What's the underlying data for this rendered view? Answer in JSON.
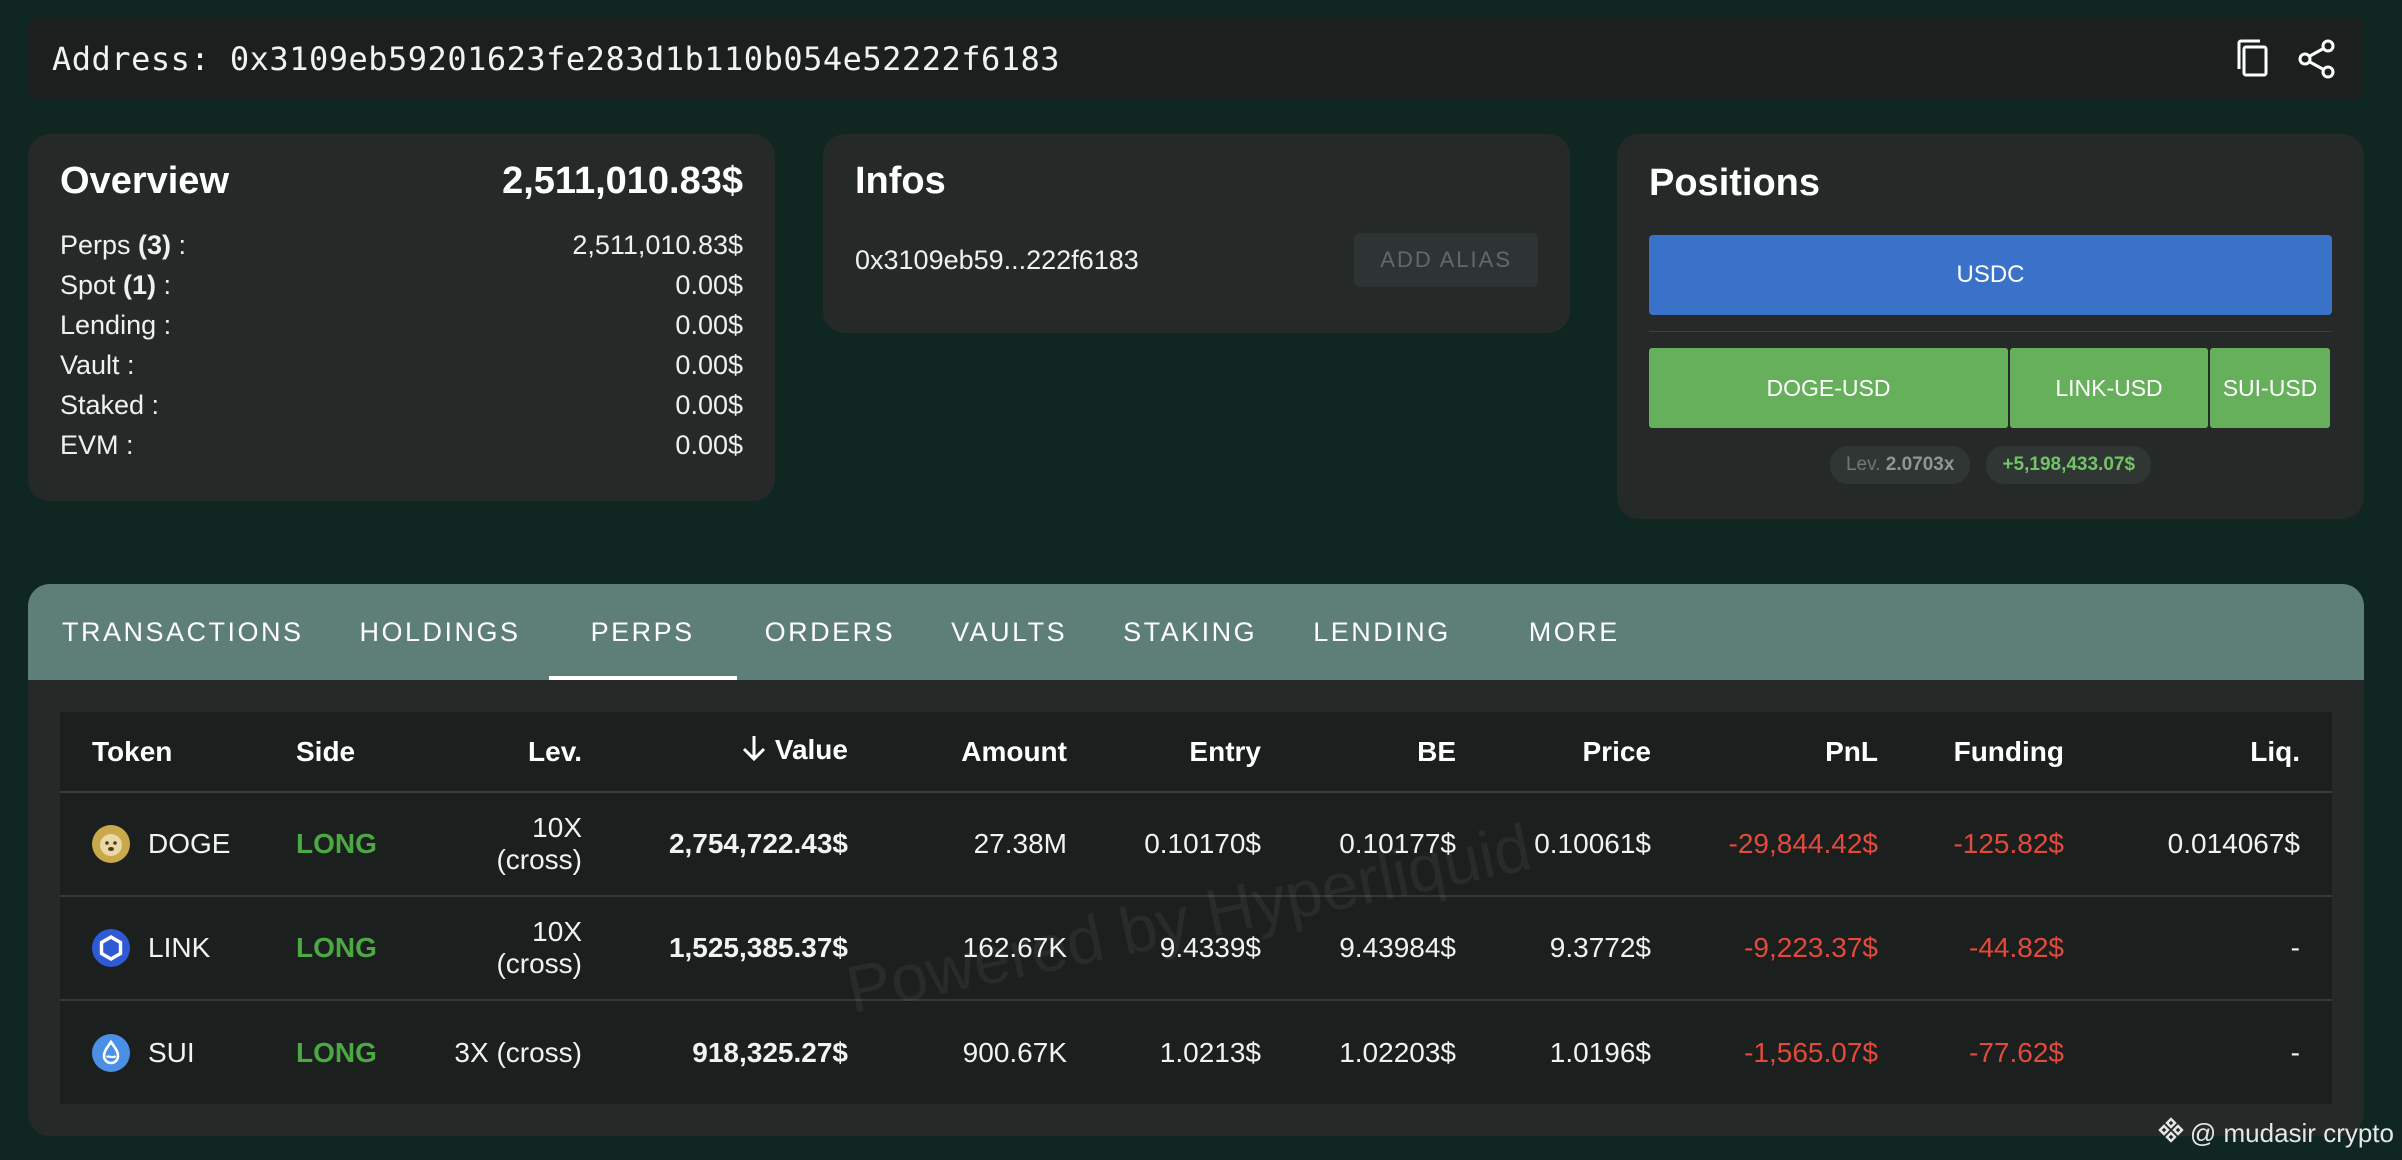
{
  "address": {
    "label": "Address: 0x3109eb59201623fe283d1b110b054e52222f6183",
    "copy_icon": "copy-icon",
    "share_icon": "share-icon"
  },
  "overview": {
    "title": "Overview",
    "total": "2,511,010.83$",
    "rows": [
      {
        "label": "Perps ",
        "count": "(3)",
        "suffix": " :",
        "value": "2,511,010.83$"
      },
      {
        "label": "Spot ",
        "count": "(1)",
        "suffix": " :",
        "value": "0.00$"
      },
      {
        "label": "Lending :",
        "count": "",
        "suffix": "",
        "value": "0.00$"
      },
      {
        "label": "Vault :",
        "count": "",
        "suffix": "",
        "value": "0.00$"
      },
      {
        "label": "Staked :",
        "count": "",
        "suffix": "",
        "value": "0.00$"
      },
      {
        "label": "EVM :",
        "count": "",
        "suffix": "",
        "value": "0.00$"
      }
    ]
  },
  "infos": {
    "title": "Infos",
    "short_address": "0x3109eb59...222f6183",
    "alias_button": "ADD ALIAS"
  },
  "positions": {
    "title": "Positions",
    "usdc_label": "USDC",
    "tiles": [
      {
        "label": "DOGE-USD"
      },
      {
        "label": "LINK-USD"
      },
      {
        "label": "SUI-USD"
      }
    ],
    "lev_label": "Lev.",
    "lev_value": "2.0703x",
    "pnl": "+5,198,433.07$",
    "colors": {
      "usdc": "#3a72c9",
      "tiles": "#66b05c"
    }
  },
  "tabs": [
    {
      "label": "TRANSACTIONS",
      "active": false
    },
    {
      "label": "HOLDINGS",
      "active": false
    },
    {
      "label": "PERPS",
      "active": true
    },
    {
      "label": "ORDERS",
      "active": false
    },
    {
      "label": "VAULTS",
      "active": false
    },
    {
      "label": "STAKING",
      "active": false
    },
    {
      "label": "LENDING",
      "active": false
    },
    {
      "label": "MORE",
      "active": false
    }
  ],
  "table": {
    "headers": {
      "token": "Token",
      "side": "Side",
      "lev": "Lev.",
      "value": "Value",
      "amount": "Amount",
      "entry": "Entry",
      "be": "BE",
      "price": "Price",
      "pnl": "PnL",
      "funding": "Funding",
      "liq": "Liq."
    },
    "sort_icon": "arrow-down-icon",
    "rows": [
      {
        "icon": "doge-icon",
        "token": "DOGE",
        "side": "LONG",
        "lev": "10X (cross)",
        "value": "2,754,722.43$",
        "amount": "27.38M",
        "entry": "0.10170$",
        "be": "0.10177$",
        "price": "0.10061$",
        "pnl": "-29,844.42$",
        "funding": "-125.82$",
        "liq": "0.014067$"
      },
      {
        "icon": "link-icon",
        "token": "LINK",
        "side": "LONG",
        "lev": "10X (cross)",
        "value": "1,525,385.37$",
        "amount": "162.67K",
        "entry": "9.4339$",
        "be": "9.43984$",
        "price": "9.3772$",
        "pnl": "-9,223.37$",
        "funding": "-44.82$",
        "liq": "-"
      },
      {
        "icon": "sui-icon",
        "token": "SUI",
        "side": "LONG",
        "lev": "3X (cross)",
        "value": "918,325.27$",
        "amount": "900.67K",
        "entry": "1.0213$",
        "be": "1.02203$",
        "price": "1.0196$",
        "pnl": "-1,565.07$",
        "funding": "-77.62$",
        "liq": "-"
      }
    ]
  },
  "watermark": "Powered by Hyperliquid",
  "credit": "@ mudasir crypto"
}
